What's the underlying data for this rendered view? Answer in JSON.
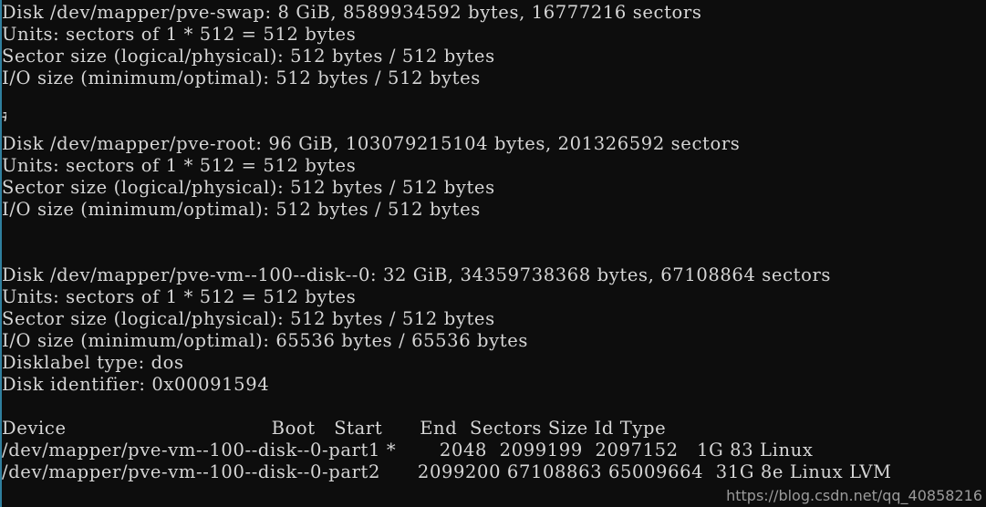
{
  "terminal": {
    "background_color": "#0d0d0d",
    "text_color": "#d6d6d6",
    "edge_color": "#2f7f9e",
    "edge_artifact_char": "#",
    "lines": [
      "Disk /dev/mapper/pve-swap: 8 GiB, 8589934592 bytes, 16777216 sectors",
      "Units: sectors of 1 * 512 = 512 bytes",
      "Sector size (logical/physical): 512 bytes / 512 bytes",
      "I/O size (minimum/optimal): 512 bytes / 512 bytes",
      "",
      "",
      "Disk /dev/mapper/pve-root: 96 GiB, 103079215104 bytes, 201326592 sectors",
      "Units: sectors of 1 * 512 = 512 bytes",
      "Sector size (logical/physical): 512 bytes / 512 bytes",
      "I/O size (minimum/optimal): 512 bytes / 512 bytes",
      "",
      "",
      "Disk /dev/mapper/pve-vm--100--disk--0: 32 GiB, 34359738368 bytes, 67108864 sectors",
      "Units: sectors of 1 * 512 = 512 bytes",
      "Sector size (logical/physical): 512 bytes / 512 bytes",
      "I/O size (minimum/optimal): 65536 bytes / 65536 bytes",
      "Disklabel type: dos",
      "Disk identifier: 0x00091594",
      "",
      "Device                                 Boot   Start      End  Sectors Size Id Type",
      "/dev/mapper/pve-vm--100--disk--0-part1 *       2048  2099199  2097152   1G 83 Linux",
      "/dev/mapper/pve-vm--100--disk--0-part2      2099200 67108863 65009664  31G 8e Linux LVM"
    ]
  },
  "disks": [
    {
      "device": "/dev/mapper/pve-swap",
      "size_human": "8 GiB",
      "size_bytes": "8589934592",
      "sectors": "16777216",
      "units": "sectors of 1 * 512 = 512 bytes",
      "sector_size_logical": "512 bytes",
      "sector_size_physical": "512 bytes",
      "io_size_minimum": "512 bytes",
      "io_size_optimal": "512 bytes"
    },
    {
      "device": "/dev/mapper/pve-root",
      "size_human": "96 GiB",
      "size_bytes": "103079215104",
      "sectors": "201326592",
      "units": "sectors of 1 * 512 = 512 bytes",
      "sector_size_logical": "512 bytes",
      "sector_size_physical": "512 bytes",
      "io_size_minimum": "512 bytes",
      "io_size_optimal": "512 bytes"
    },
    {
      "device": "/dev/mapper/pve-vm--100--disk--0",
      "size_human": "32 GiB",
      "size_bytes": "34359738368",
      "sectors": "67108864",
      "units": "sectors of 1 * 512 = 512 bytes",
      "sector_size_logical": "512 bytes",
      "sector_size_physical": "512 bytes",
      "io_size_minimum": "65536 bytes",
      "io_size_optimal": "65536 bytes",
      "disklabel_type": "dos",
      "disk_identifier": "0x00091594"
    }
  ],
  "partition_table": {
    "headers": [
      "Device",
      "Boot",
      "Start",
      "End",
      "Sectors",
      "Size",
      "Id",
      "Type"
    ],
    "rows": [
      {
        "device": "/dev/mapper/pve-vm--100--disk--0-part1",
        "boot": "*",
        "start": "2048",
        "end": "2099199",
        "sectors": "2097152",
        "size": "1G",
        "id": "83",
        "type": "Linux"
      },
      {
        "device": "/dev/mapper/pve-vm--100--disk--0-part2",
        "boot": "",
        "start": "2099200",
        "end": "67108863",
        "sectors": "65009664",
        "size": "31G",
        "id": "8e",
        "type": "Linux LVM"
      }
    ]
  },
  "watermark": {
    "text": "https://blog.csdn.net/qq_40858216"
  }
}
